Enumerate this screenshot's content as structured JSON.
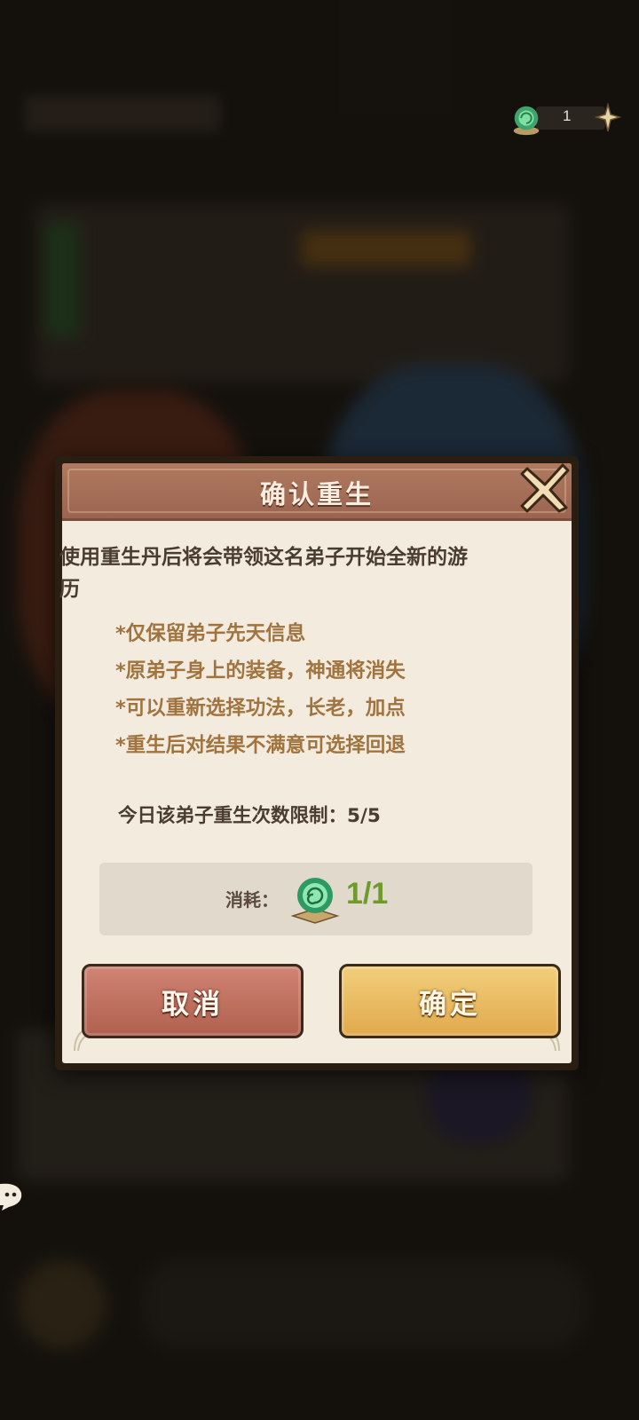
{
  "header": {
    "currency_count": "1"
  },
  "dialog": {
    "title": "确认重生",
    "description": "使用重生丹后将会带领这名弟子开始全新的游历",
    "bullets": [
      "*仅保留弟子先天信息",
      "*原弟子身上的装备，神通将消失",
      "*可以重新选择功法，长老，加点",
      "*重生后对结果不满意可选择回退"
    ],
    "limit_text": "今日该弟子重生次数限制：5/5",
    "cost_label": "消耗：",
    "cost_value": "1/1",
    "cancel_label": "取消",
    "confirm_label": "确定"
  },
  "colors": {
    "accent_bullet": "#a0733f",
    "cost_green": "#6e9a2e",
    "header_brown": "#a36b56"
  },
  "icons": [
    "rebirth-pill-icon",
    "plus-icon",
    "close-icon",
    "chat-icon"
  ]
}
